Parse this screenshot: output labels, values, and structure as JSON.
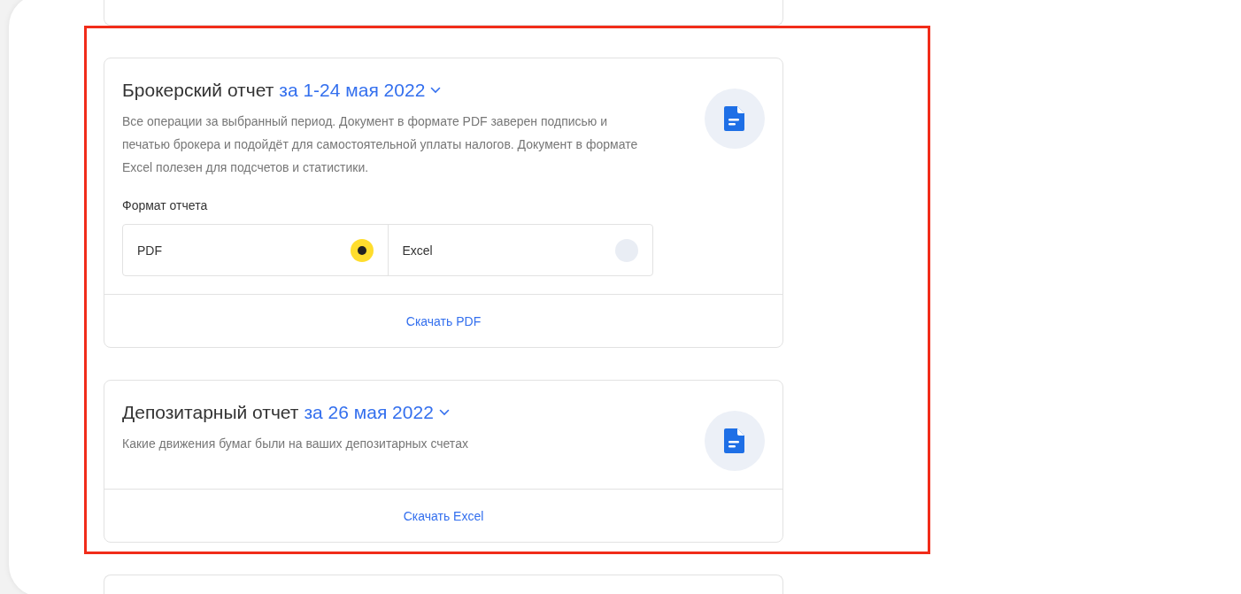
{
  "reports": [
    {
      "title": "Брокерский отчет",
      "period": "за 1-24 мая 2022",
      "description": "Все операции за выбранный период. Документ в формате PDF заверен подписью и печатью брокера и подойдёт для самостоятельной уплаты налогов. Документ в формате Excel полезен для подсчетов и статистики.",
      "format_label": "Формат отчета",
      "formats": [
        {
          "label": "PDF",
          "selected": true
        },
        {
          "label": "Excel",
          "selected": false
        }
      ],
      "download_link": "Скачать PDF"
    },
    {
      "title": "Депозитарный отчет",
      "period": "за 26 мая 2022",
      "description": "Какие движения бумаг были на ваших депозитарных счетах",
      "download_link": "Скачать Excel"
    }
  ]
}
